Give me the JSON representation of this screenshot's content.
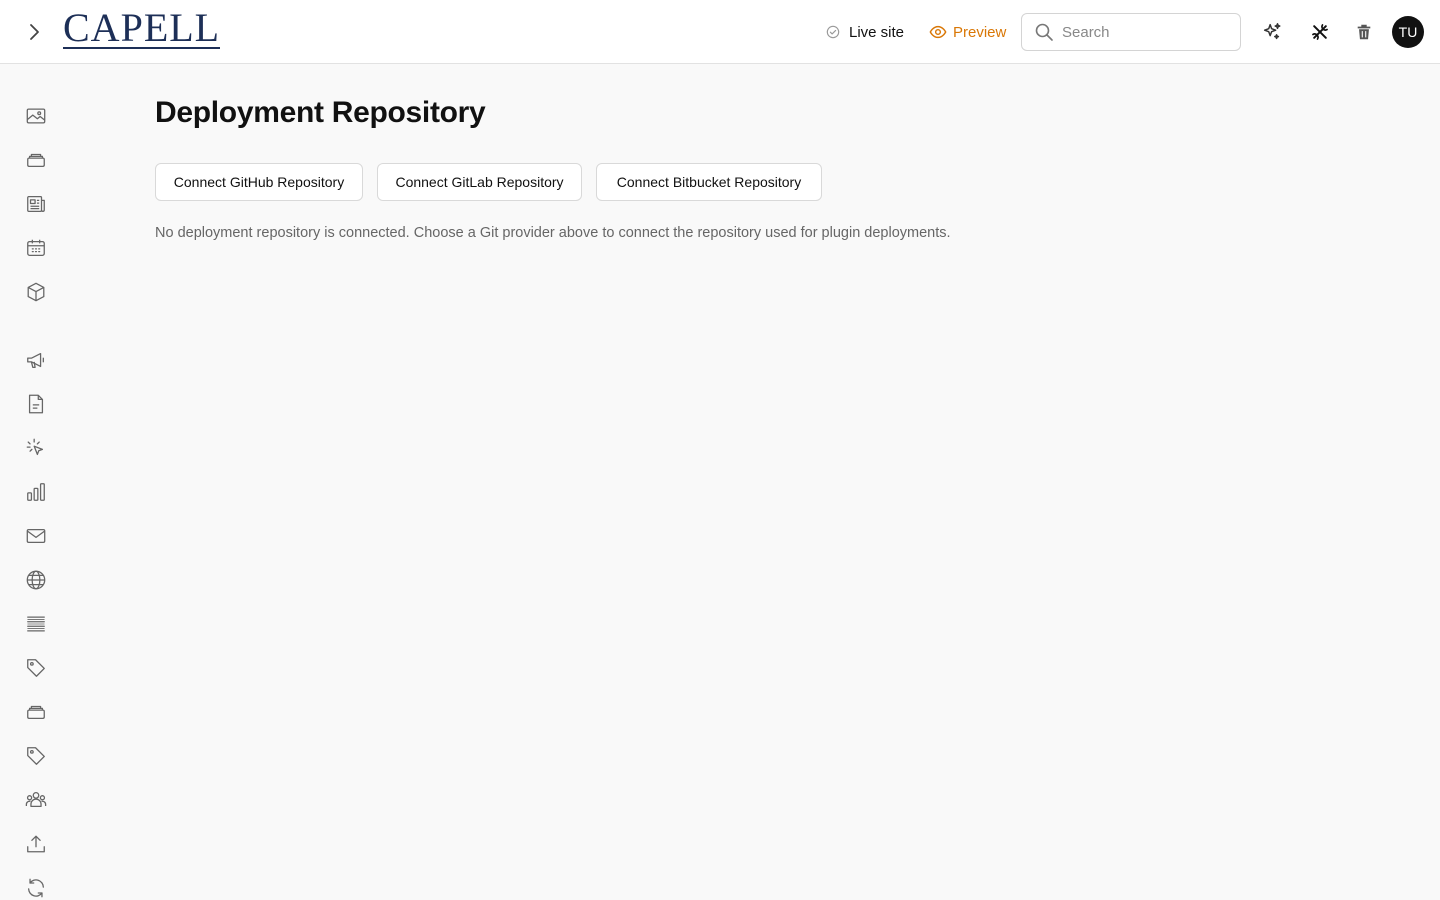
{
  "header": {
    "logo_text": "CAPELL",
    "live_site_label": "Live site",
    "preview_label": "Preview",
    "search_placeholder": "Search",
    "avatar_initials": "TU",
    "accent_color": "#d97706"
  },
  "sidebar": {
    "icons": [
      "image-icon",
      "layers-icon",
      "newspaper-icon",
      "calendar-icon",
      "box-icon",
      "megaphone-icon",
      "document-icon",
      "cursor-click-icon",
      "bar-chart-icon",
      "mail-icon",
      "globe-icon",
      "list-icon",
      "tag-icon",
      "layers-icon",
      "tag-icon",
      "users-icon",
      "upload-icon",
      "refresh-icon"
    ]
  },
  "main": {
    "title": "Deployment Repository",
    "buttons": [
      "Connect GitHub Repository",
      "Connect GitLab Repository",
      "Connect Bitbucket Repository"
    ],
    "info": "No deployment repository is connected. Choose a Git provider above to connect the repository used for plugin deployments."
  }
}
